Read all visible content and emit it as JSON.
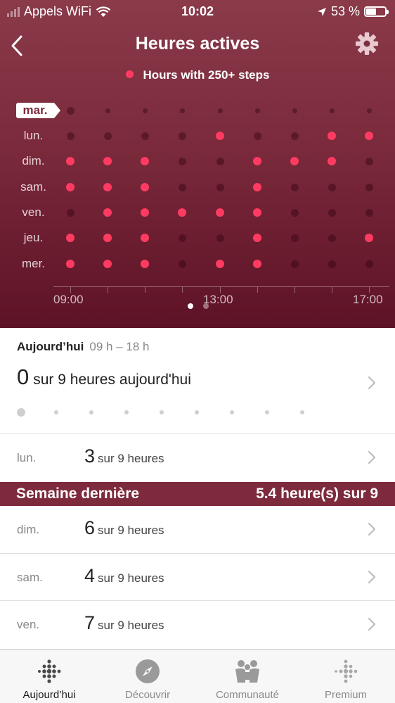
{
  "status_bar": {
    "carrier": "Appels WiFi",
    "time": "10:02",
    "battery_percent": "53 %",
    "battery_level": 0.53
  },
  "nav": {
    "title": "Heures actives",
    "back_icon": "chevron-left-icon",
    "settings_icon": "gear-icon"
  },
  "legend": {
    "label": "Hours with 250+ steps",
    "color": "#ff3b62"
  },
  "grid": {
    "days": [
      "mar.",
      "lun.",
      "dim.",
      "sam.",
      "ven.",
      "jeu.",
      "mer."
    ],
    "current_day": "mar.",
    "x_labels": [
      "09:00",
      "13:00",
      "17:00"
    ],
    "active": [
      [
        0,
        0,
        0,
        0,
        0,
        0,
        0,
        0,
        0
      ],
      [
        0,
        0,
        0,
        0,
        1,
        0,
        0,
        1,
        1
      ],
      [
        1,
        1,
        1,
        0,
        0,
        1,
        1,
        1,
        0
      ],
      [
        1,
        1,
        1,
        0,
        0,
        1,
        0,
        0,
        0
      ],
      [
        0,
        1,
        1,
        1,
        1,
        1,
        0,
        0,
        0
      ],
      [
        1,
        1,
        1,
        0,
        0,
        1,
        0,
        0,
        1
      ],
      [
        1,
        1,
        1,
        0,
        1,
        1,
        0,
        0,
        0
      ]
    ],
    "pager": {
      "pages": 2,
      "current": 0
    }
  },
  "today": {
    "label": "Aujourd’hui",
    "range": "09 h – 18 h",
    "count": "0",
    "text": "sur 9 heures aujourd'hui"
  },
  "yesterday": {
    "day": "lun.",
    "count": "3",
    "text": "sur 9 heures"
  },
  "last_week": {
    "title": "Semaine dernière",
    "summary": "5.4 heure(s) sur 9"
  },
  "rows": [
    {
      "day": "dim.",
      "count": "6",
      "text": "sur 9 heures"
    },
    {
      "day": "sam.",
      "count": "4",
      "text": "sur 9 heures"
    },
    {
      "day": "ven.",
      "count": "7",
      "text": "sur 9 heures"
    }
  ],
  "tabs": [
    {
      "label": "Aujourd’hui",
      "icon": "fitbit-dots-icon",
      "active": true
    },
    {
      "label": "Découvrir",
      "icon": "compass-icon",
      "active": false
    },
    {
      "label": "Communauté",
      "icon": "community-icon",
      "active": false
    },
    {
      "label": "Premium",
      "icon": "premium-dots-icon",
      "active": false
    }
  ]
}
